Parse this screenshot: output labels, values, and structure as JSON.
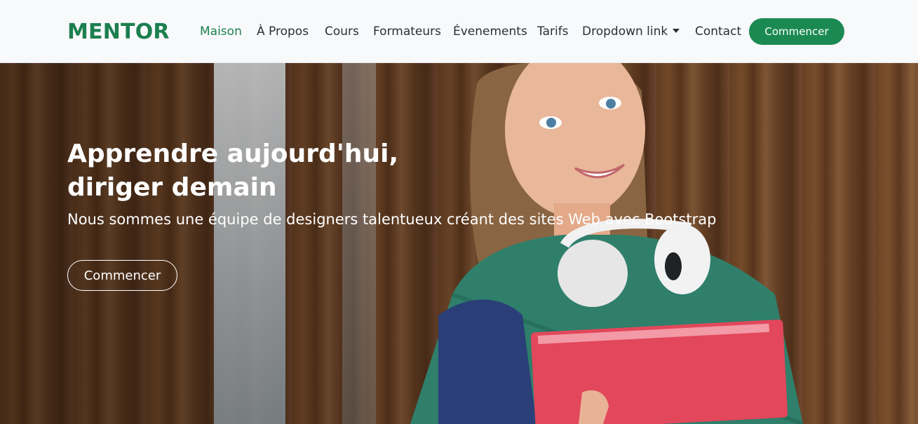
{
  "navbar": {
    "brand": "MENTOR",
    "links": [
      {
        "label": "Maison",
        "active": true
      },
      {
        "label": "À Propos"
      },
      {
        "label": "Cours"
      },
      {
        "label": "Formateurs"
      },
      {
        "label": "Évenements"
      },
      {
        "label": "Tarifs"
      },
      {
        "label": "Dropdown link",
        "dropdown": true
      },
      {
        "label": "Contact"
      }
    ],
    "cta_label": "Commencer"
  },
  "hero": {
    "title_line1": "Apprendre aujourd'hui,",
    "title_line2": "diriger demain",
    "subtitle": "Nous sommes une équipe de designers talentueux créant des sites Web avec Bootstrap",
    "cta_label": "Commencer"
  },
  "colors": {
    "brand_green": "#1b7f4e",
    "button_green": "#1b8a52",
    "navbar_bg": "#f8f9fb"
  },
  "icons": {
    "dropdown": "caret-down-icon"
  }
}
